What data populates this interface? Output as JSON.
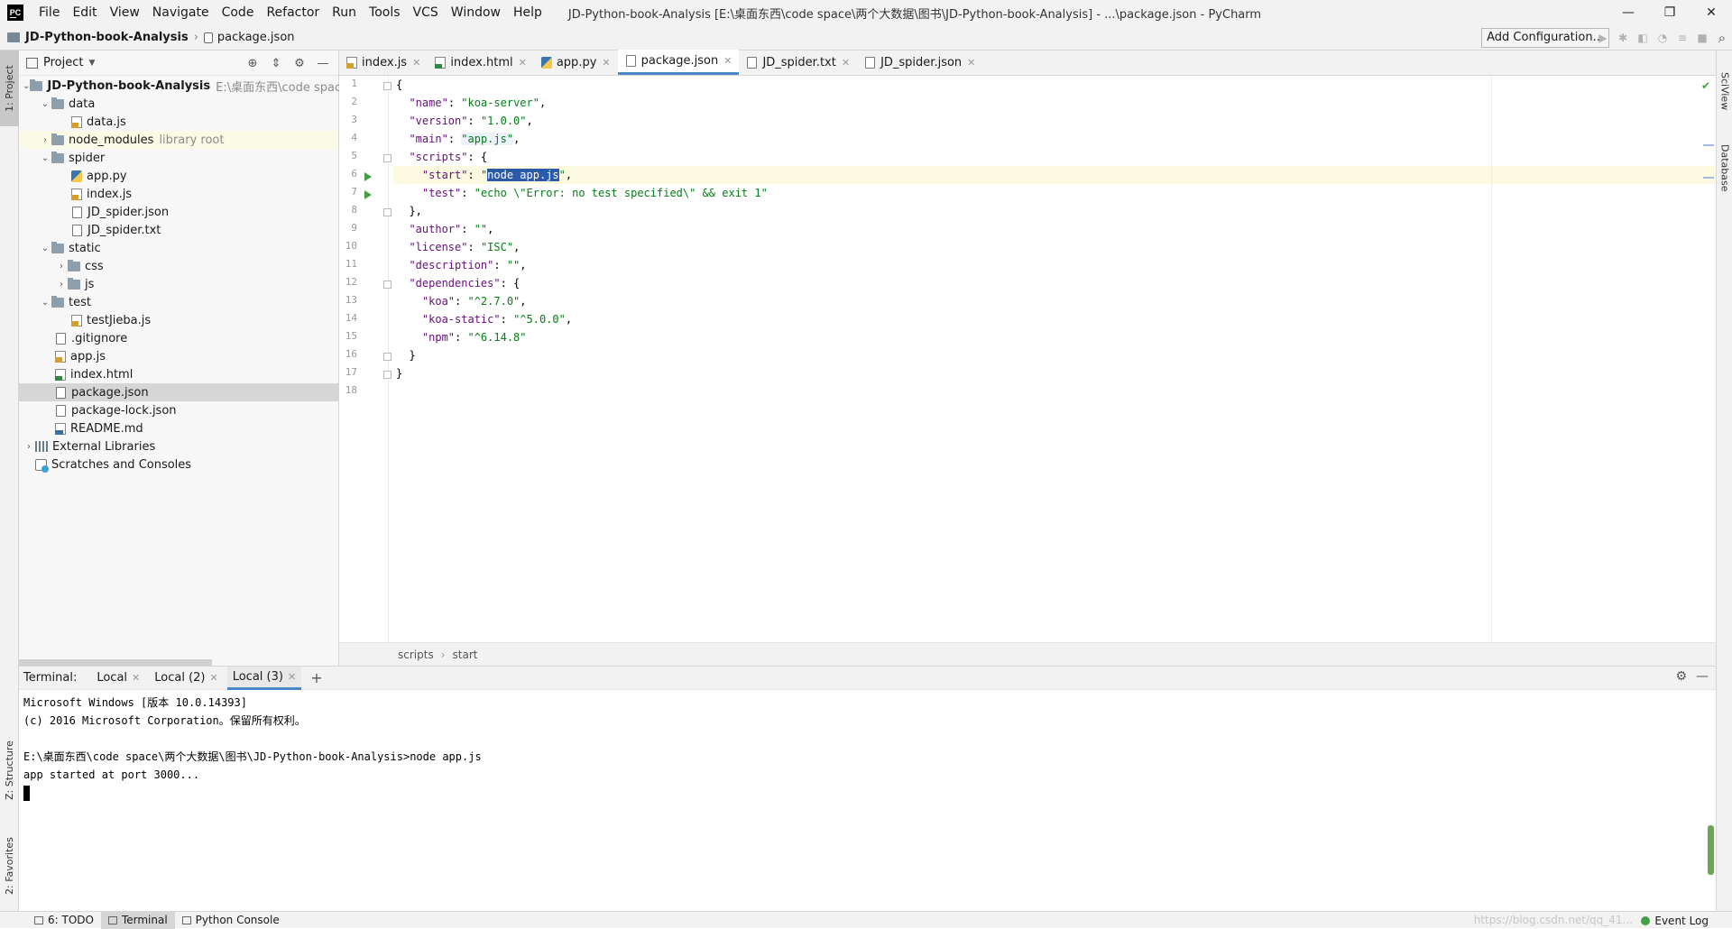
{
  "titlebar": {
    "logo": "PC",
    "menu": [
      "File",
      "Edit",
      "View",
      "Navigate",
      "Code",
      "Refactor",
      "Run",
      "Tools",
      "VCS",
      "Window",
      "Help"
    ],
    "window_title": "JD-Python-book-Analysis [E:\\桌面东西\\code space\\两个大数据\\图书\\JD-Python-book-Analysis] - ...\\package.json - PyCharm",
    "controls": [
      "—",
      "❐",
      "✕"
    ]
  },
  "navbar": {
    "project": "JD-Python-book-Analysis",
    "file": "package.json",
    "run_config": "Add Configuration..."
  },
  "left_stripe": {
    "project": "1: Project",
    "structure": "Z: Structure",
    "favorites": "2: Favorites"
  },
  "right_stripe": {
    "sciview": "SciView",
    "database": "Database"
  },
  "project_panel": {
    "title": "Project",
    "root": {
      "name": "JD-Python-book-Analysis",
      "path": "E:\\桌面东西\\code space\\两"
    },
    "items": [
      {
        "label": "data"
      },
      {
        "label": "data.js"
      },
      {
        "label": "node_modules",
        "hint": "library root"
      },
      {
        "label": "spider"
      },
      {
        "label": "app.py"
      },
      {
        "label": "index.js"
      },
      {
        "label": "JD_spider.json"
      },
      {
        "label": "JD_spider.txt"
      },
      {
        "label": "static"
      },
      {
        "label": "css"
      },
      {
        "label": "js"
      },
      {
        "label": "test"
      },
      {
        "label": "testJieba.js"
      },
      {
        "label": ".gitignore"
      },
      {
        "label": "app.js"
      },
      {
        "label": "index.html"
      },
      {
        "label": "package.json"
      },
      {
        "label": "package-lock.json"
      },
      {
        "label": "README.md"
      },
      {
        "label": "External Libraries"
      },
      {
        "label": "Scratches and Consoles"
      }
    ]
  },
  "editor": {
    "tabs": [
      "index.js",
      "index.html",
      "app.py",
      "package.json",
      "JD_spider.txt",
      "JD_spider.json"
    ],
    "active_tab": "package.json",
    "line_numbers": [
      "1",
      "2",
      "3",
      "4",
      "5",
      "6",
      "7",
      "8",
      "9",
      "10",
      "11",
      "12",
      "13",
      "14",
      "15",
      "16",
      "17",
      "18"
    ],
    "code": {
      "l1": "{",
      "l2_key": "\"name\"",
      "l2_val": "\"koa-server\"",
      "l3_key": "\"version\"",
      "l3_val": "\"1.0.0\"",
      "l4_key": "\"main\"",
      "l4_val": "\"app.js\"",
      "l5_key": "\"scripts\"",
      "l5_rest": ": {",
      "l6_key": "\"start\"",
      "l6_q1": "\"",
      "l6_sel": "node app.js",
      "l6_q2": "\"",
      "l7_key": "\"test\"",
      "l7_val": "\"echo \\\"Error: no test specified\\\" && exit 1\"",
      "l8": "},",
      "l9_key": "\"author\"",
      "l9_val": "\"\"",
      "l10_key": "\"license\"",
      "l10_val": "\"ISC\"",
      "l11_key": "\"description\"",
      "l11_val": "\"\"",
      "l12_key": "\"dependencies\"",
      "l12_rest": ": {",
      "l13_key": "\"koa\"",
      "l13_val": "\"^2.7.0\"",
      "l14_key": "\"koa-static\"",
      "l14_val": "\"^5.0.0\"",
      "l15_key": "\"npm\"",
      "l15_val": "\"^6.14.8\"",
      "l16": "}",
      "l17": "}"
    },
    "breadcrumbs": [
      "scripts",
      "start"
    ]
  },
  "terminal": {
    "label": "Terminal:",
    "tabs": [
      "Local",
      "Local (2)",
      "Local (3)"
    ],
    "active_tab": "Local (3)",
    "lines": [
      "Microsoft Windows [版本 10.0.14393]",
      "(c) 2016 Microsoft Corporation。保留所有权利。",
      "",
      "E:\\桌面东西\\code space\\两个大数据\\图书\\JD-Python-book-Analysis>node app.js",
      "app started at port 3000..."
    ]
  },
  "statusbar": {
    "todo": "6: TODO",
    "terminal": "Terminal",
    "python_console": "Python Console",
    "watermark": "https://blog.csdn.net/qq_41...",
    "event_log": "Event Log"
  },
  "colors": {
    "accent": "#4a88c7",
    "string": "#067d17",
    "key": "#660e7a",
    "selection": "#2a5aa8",
    "run_icon": "#45a049"
  }
}
